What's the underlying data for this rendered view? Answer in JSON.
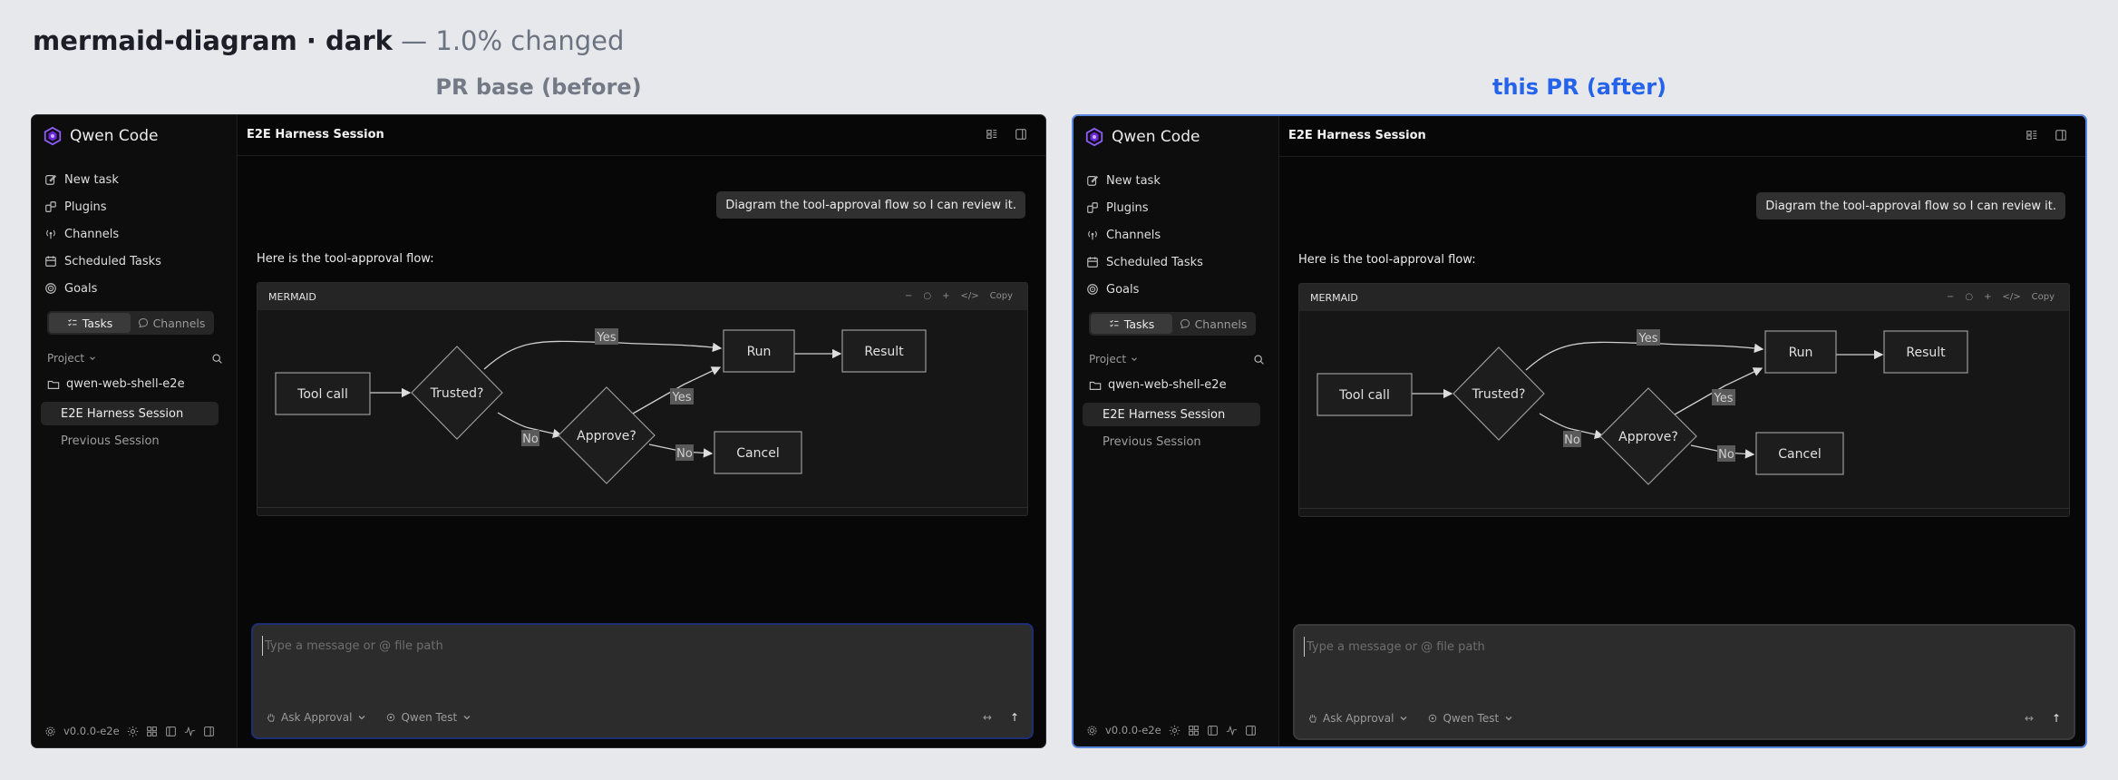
{
  "header": {
    "title": "mermaid-diagram · dark",
    "subtitle": " — 1.0% changed"
  },
  "panels": {
    "before_label": "PR base (before)",
    "after_label": "this PR (after)"
  },
  "app": {
    "brand": "Qwen Code",
    "nav": {
      "new_task": "New task",
      "plugins": "Plugins",
      "channels": "Channels",
      "scheduled_tasks": "Scheduled Tasks",
      "goals": "Goals"
    },
    "tabs": {
      "tasks": "Tasks",
      "channels": "Channels"
    },
    "project_label": "Project",
    "repo": "qwen-web-shell-e2e",
    "sessions": {
      "active": "E2E Harness Session",
      "previous": "Previous Session"
    },
    "version": "v0.0.0-e2e",
    "session_title": "E2E Harness Session",
    "user_message": "Diagram the tool-approval flow so I can review it.",
    "assistant_message": "Here is the tool-approval flow:",
    "code_block": {
      "lang": "MERMAID",
      "tools": {
        "zoom_out": "−",
        "reset": "○",
        "zoom_in": "+",
        "source": "</>",
        "copy": "Copy"
      }
    },
    "diagram": {
      "nodes": {
        "tool_call": "Tool call",
        "trusted": "Trusted?",
        "approve": "Approve?",
        "run": "Run",
        "result": "Result",
        "cancel": "Cancel"
      },
      "edges": {
        "yes": "Yes",
        "no": "No"
      }
    },
    "composer": {
      "placeholder": "Type a message or @ file path",
      "mode": "Ask Approval",
      "model": "Qwen Test",
      "expand": "↔",
      "send": "↑"
    },
    "colors": {
      "accent": "#2563eb",
      "composer_focus": "#1f2f74",
      "frame_after_border": "#5b86dd"
    },
    "icons": [
      "qwen-logo-icon",
      "pencil-square-icon",
      "plugin-icon",
      "antenna-icon",
      "calendar-icon",
      "target-icon",
      "list-check-icon",
      "chat-bubble-icon",
      "chevron-down-icon",
      "search-icon",
      "folder-icon",
      "gear-icon",
      "grid-icon",
      "sidebar-icon",
      "activity-icon",
      "layout-icon",
      "hand-icon",
      "sparkle-icon"
    ]
  }
}
